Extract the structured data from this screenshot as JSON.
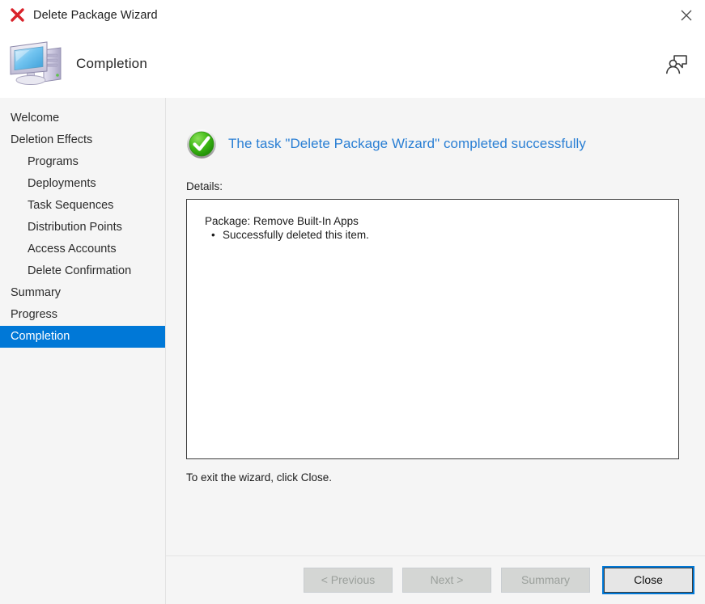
{
  "window": {
    "title": "Delete Package Wizard",
    "title_icon": "red-x-icon",
    "close_icon": "close-icon"
  },
  "header": {
    "title": "Completion",
    "icon": "computer-icon",
    "help_icon": "feedback-person-icon"
  },
  "sidebar": {
    "items": [
      {
        "label": "Welcome",
        "level": 0,
        "selected": false
      },
      {
        "label": "Deletion Effects",
        "level": 0,
        "selected": false
      },
      {
        "label": "Programs",
        "level": 1,
        "selected": false
      },
      {
        "label": "Deployments",
        "level": 1,
        "selected": false
      },
      {
        "label": "Task Sequences",
        "level": 1,
        "selected": false
      },
      {
        "label": "Distribution Points",
        "level": 1,
        "selected": false
      },
      {
        "label": "Access Accounts",
        "level": 1,
        "selected": false
      },
      {
        "label": "Delete Confirmation",
        "level": 1,
        "selected": false
      },
      {
        "label": "Summary",
        "level": 0,
        "selected": false
      },
      {
        "label": "Progress",
        "level": 0,
        "selected": false
      },
      {
        "label": "Completion",
        "level": 0,
        "selected": true
      }
    ],
    "selected_bg": "#0078d7",
    "selected_fg": "#ffffff"
  },
  "main": {
    "status_icon": "green-check-circle-icon",
    "status_text": "The task \"Delete Package Wizard\" completed successfully",
    "status_color": "#2a7fd4",
    "details_label": "Details:",
    "details": {
      "package_line": "Package: Remove Built-In Apps",
      "bullets": [
        "Successfully deleted this item."
      ]
    },
    "exit_note": "To exit the wizard, click Close."
  },
  "footer": {
    "buttons": [
      {
        "label": "< Previous",
        "enabled": false
      },
      {
        "label": "Next >",
        "enabled": false
      },
      {
        "label": "Summary",
        "enabled": false
      },
      {
        "label": "Close",
        "enabled": true,
        "focused": true
      }
    ]
  }
}
